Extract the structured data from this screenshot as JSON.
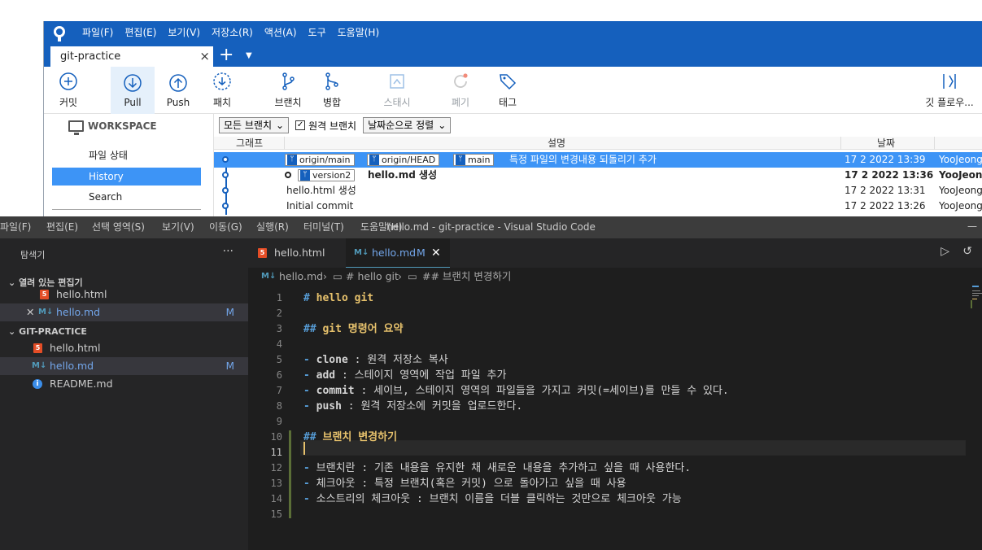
{
  "sourcetree": {
    "menu": [
      "파일(F)",
      "편집(E)",
      "보기(V)",
      "저장소(R)",
      "액션(A)",
      "도구",
      "도움말(H)"
    ],
    "tab": {
      "title": "git-practice",
      "close": "×"
    },
    "new_tab": "+",
    "toolbar": {
      "commit": "커밋",
      "pull": "Pull",
      "push": "Push",
      "patch": "패치",
      "branch": "브랜치",
      "merge": "병합",
      "stash": "스태시",
      "discard": "폐기",
      "tag": "태그",
      "git_flow": "깃 플로우..."
    },
    "sidebar": {
      "workspace": "WORKSPACE",
      "items": [
        "파일 상태",
        "History",
        "Search"
      ]
    },
    "filters": {
      "branches": "모든 브랜치",
      "remote_branches": "원격 브랜치",
      "remote_checked": true,
      "sort": "날짜순으로 정렬"
    },
    "columns": {
      "graph": "그래프",
      "description": "설명",
      "date": "날짜"
    },
    "commits": [
      {
        "badges": [
          "origin/main",
          "origin/HEAD",
          "main"
        ],
        "message": "특정 파일의 변경내용 되돌리기 추가",
        "date": "17 2 2022 13:39",
        "author": "YooJeong"
      },
      {
        "badges": [
          "version2"
        ],
        "message": "hello.md 생성",
        "date": "17 2 2022 13:36",
        "author": "YooJeong"
      },
      {
        "badges": [],
        "message": "hello.html 생성",
        "date": "17 2 2022 13:31",
        "author": "YooJeong"
      },
      {
        "badges": [],
        "message": "Initial commit",
        "date": "17 2 2022 13:26",
        "author": "YooJeong"
      }
    ]
  },
  "vscode": {
    "menu": [
      "파일(F)",
      "편집(E)",
      "선택 영역(S)",
      "보기(V)",
      "이동(G)",
      "실행(R)",
      "터미널(T)",
      "도움말(H)"
    ],
    "window_title": "hello.md - git-practice - Visual Studio Code",
    "explorer": {
      "title": "탐색기",
      "more": "···",
      "open_editors": "열려 있는 편집기",
      "project": "GIT-PRACTICE",
      "open_files": [
        {
          "name": "hello.html",
          "modified": ""
        },
        {
          "name": "hello.md",
          "modified": "M"
        }
      ],
      "files": [
        {
          "name": "hello.html",
          "modified": ""
        },
        {
          "name": "hello.md",
          "modified": "M"
        },
        {
          "name": "README.md",
          "modified": ""
        }
      ]
    },
    "tabs": [
      {
        "name": "hello.html",
        "status": ""
      },
      {
        "name": "hello.md",
        "status": "M"
      }
    ],
    "breadcrumb": [
      "hello.md",
      "# hello git",
      "## 브랜치 변경하기"
    ],
    "editor": {
      "current_line": 11,
      "lines": [
        {
          "n": "1",
          "t": "# hello git"
        },
        {
          "n": "2",
          "t": ""
        },
        {
          "n": "3",
          "t": "## git 명령어 요약"
        },
        {
          "n": "4",
          "t": ""
        },
        {
          "n": "5",
          "t": "- clone : 원격 저장소 복사"
        },
        {
          "n": "6",
          "t": "- add : 스테이지 영역에 작업 파일 추가"
        },
        {
          "n": "7",
          "t": "- commit : 세이브, 스테이지 영역의 파일들을 가지고 커밋(=세이브)를 만들 수 있다."
        },
        {
          "n": "8",
          "t": "- push : 원격 저장소에 커밋을 업로드한다."
        },
        {
          "n": "9",
          "t": ""
        },
        {
          "n": "10",
          "t": "## 브랜치 변경하기"
        },
        {
          "n": "11",
          "t": ""
        },
        {
          "n": "12",
          "t": "- 브랜치란 : 기존 내용을 유지한 채 새로운 내용을 추가하고 싶을 때 사용한다."
        },
        {
          "n": "13",
          "t": "- 체크아웃 : 특정 브랜치(혹은 커밋) 으로 돌아가고 싶을 때 사용"
        },
        {
          "n": "14",
          "t": "- 소스트리의 체크아웃 : 브랜치 이름을 더블 클릭하는 것만으로 체크아웃 가능"
        },
        {
          "n": "15",
          "t": ""
        }
      ]
    }
  }
}
